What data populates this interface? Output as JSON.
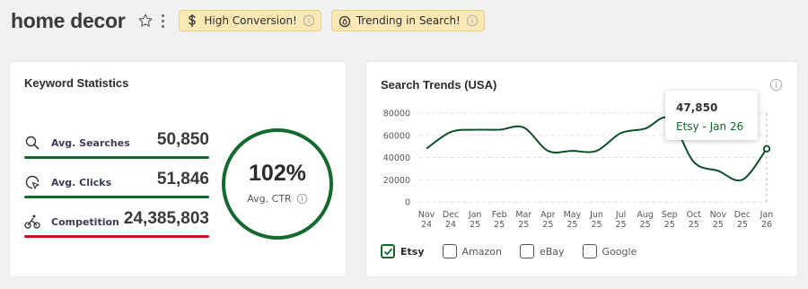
{
  "header": {
    "title": "home decor",
    "badges": [
      {
        "label": "High Conversion!",
        "icon": "dollar-icon"
      },
      {
        "label": "Trending in Search!",
        "icon": "flame-icon"
      }
    ]
  },
  "stats_card": {
    "title": "Keyword Statistics",
    "rows": [
      {
        "label": "Avg. Searches",
        "value": "50,850",
        "icon": "search-icon",
        "color": "#14692e"
      },
      {
        "label": "Avg. Clicks",
        "value": "51,846",
        "icon": "click-cursor-icon",
        "color": "#14692e"
      },
      {
        "label": "Competition",
        "value": "24,385,803",
        "icon": "cyclist-icon",
        "color": "#c8141e"
      }
    ],
    "ctr": {
      "value": "102%",
      "label": "Avg. CTR"
    }
  },
  "trends_card": {
    "title": "Search Trends (USA)",
    "tooltip": {
      "value": "47,850",
      "label": "Etsy - Jan 26"
    },
    "legend": [
      {
        "label": "Etsy",
        "checked": true
      },
      {
        "label": "Amazon",
        "checked": false
      },
      {
        "label": "eBay",
        "checked": false
      },
      {
        "label": "Google",
        "checked": false
      }
    ]
  },
  "colors": {
    "accent": "#14692e",
    "danger": "#c8141e",
    "badge_bg": "#fbe9b5"
  },
  "chart_data": {
    "type": "line",
    "title": "Search Trends (USA)",
    "x_ticks": [
      [
        "Nov",
        "24"
      ],
      [
        "Dec",
        "24"
      ],
      [
        "Jan",
        "25"
      ],
      [
        "Feb",
        "25"
      ],
      [
        "Mar",
        "25"
      ],
      [
        "Apr",
        "25"
      ],
      [
        "May",
        "25"
      ],
      [
        "Jun",
        "25"
      ],
      [
        "Jul",
        "25"
      ],
      [
        "Aug",
        "25"
      ],
      [
        "Sep",
        "25"
      ],
      [
        "Oct",
        "25"
      ],
      [
        "Nov",
        "25"
      ],
      [
        "Dec",
        "25"
      ],
      [
        "Jan",
        "26"
      ]
    ],
    "y_ticks": [
      "80000",
      "60000",
      "40000",
      "20000",
      "0"
    ],
    "ylim": [
      0,
      80000
    ],
    "grid": true,
    "series": [
      {
        "name": "Etsy",
        "values": [
          48000,
          63000,
          65000,
          65000,
          67000,
          46000,
          46000,
          46000,
          62000,
          66000,
          75000,
          36000,
          28000,
          20000,
          47850
        ]
      }
    ]
  }
}
